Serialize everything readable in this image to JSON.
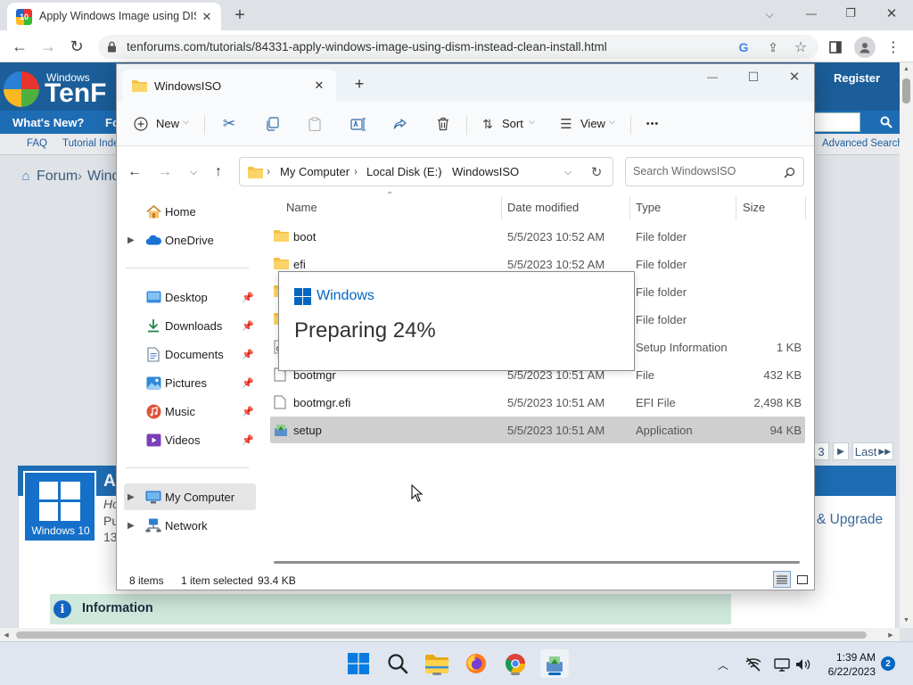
{
  "browser": {
    "tab_title": "Apply Windows Image using DISM",
    "new_tab": "+",
    "url": "tenforums.com/tutorials/84331-apply-windows-image-using-dism-instead-clean-install.html",
    "window_controls": {
      "minimize": "—",
      "maximize": "❐",
      "close": "✕"
    }
  },
  "site": {
    "logo_small": "Windows",
    "logo_big": "TenF",
    "register": "Register",
    "nav_whats_new": "What's New?",
    "nav_fo": "Fo",
    "subnav_faq": "FAQ",
    "subnav_tutorial": "Tutorial Inde",
    "advanced_search": "Advanced Search",
    "breadcrumb_forum": "Forum",
    "breadcrumb_next": "Windc",
    "pagination_3": "3",
    "pagination_last": "Last",
    "article_initial": "A",
    "article_by": "Hc",
    "article_pub": "Pu",
    "article_num": "13",
    "badge_label": "Windows 10",
    "category_link": "& Upgrade",
    "info_label": "Information"
  },
  "explorer": {
    "tab_title": "WindowsISO",
    "new_tab": "+",
    "window_controls": {
      "minimize": "—",
      "maximize": "☐",
      "close": "✕"
    },
    "cmd": {
      "new": "New",
      "sort": "Sort",
      "view": "View",
      "more": "•••"
    },
    "breadcrumb": [
      "My Computer",
      "Local Disk (E:)",
      "WindowsISO"
    ],
    "search_placeholder": "Search WindowsISO",
    "nav": {
      "home": "Home",
      "onedrive": "OneDrive",
      "desktop": "Desktop",
      "downloads": "Downloads",
      "documents": "Documents",
      "pictures": "Pictures",
      "music": "Music",
      "videos": "Videos",
      "my_computer": "My Computer",
      "network": "Network"
    },
    "columns": {
      "name": "Name",
      "date": "Date modified",
      "type": "Type",
      "size": "Size"
    },
    "files": [
      {
        "name": "boot",
        "date": "5/5/2023 10:52 AM",
        "type": "File folder",
        "size": "",
        "icon": "folder-icon"
      },
      {
        "name": "efi",
        "date": "5/5/2023 10:52 AM",
        "type": "File folder",
        "size": "",
        "icon": "folder-icon"
      },
      {
        "name": "",
        "date": "",
        "type": "File folder",
        "size": "",
        "icon": "folder-icon"
      },
      {
        "name": "",
        "date": "",
        "type": "File folder",
        "size": "",
        "icon": "folder-icon"
      },
      {
        "name": "",
        "date": "",
        "type": "Setup Information",
        "size": "1 KB",
        "icon": "settings-file-icon"
      },
      {
        "name": "bootmgr",
        "date": "5/5/2023 10:51 AM",
        "type": "File",
        "size": "432 KB",
        "icon": "file-icon"
      },
      {
        "name": "bootmgr.efi",
        "date": "5/5/2023 10:51 AM",
        "type": "EFI File",
        "size": "2,498 KB",
        "icon": "file-icon"
      },
      {
        "name": "setup",
        "date": "5/5/2023 10:51 AM",
        "type": "Application",
        "size": "94 KB",
        "icon": "setup-app-icon"
      }
    ],
    "status": {
      "items": "8 items",
      "selected": "1 item selected",
      "size": "93.4 KB"
    }
  },
  "dialog": {
    "brand": "Windows",
    "message": "Preparing 24%"
  },
  "taskbar": {
    "time": "1:39 AM",
    "date": "6/22/2023",
    "notifications": "2"
  },
  "colors": {
    "accent": "#0067c0",
    "site_blue": "#1e6db4",
    "selected_row": "#cfcfcf",
    "folder": "#f4c046"
  }
}
